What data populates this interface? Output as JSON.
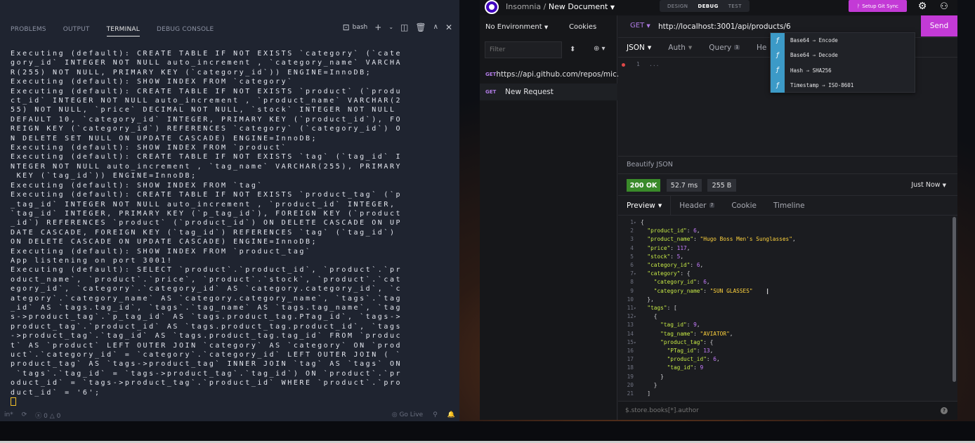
{
  "terminal_panel": {
    "tabs": [
      {
        "label": "PROBLEMS",
        "active": false
      },
      {
        "label": "OUTPUT",
        "active": false
      },
      {
        "label": "TERMINAL",
        "active": true
      },
      {
        "label": "DEBUG CONSOLE",
        "active": false
      }
    ],
    "shell_label": "bash",
    "lines": [
      "Executing (default): CREATE TABLE IF NOT EXISTS `category` (`cate",
      "gory_id` INTEGER NOT NULL auto_increment , `category_name` VARCHA",
      "R(255) NOT NULL, PRIMARY KEY (`category_id`)) ENGINE=InnoDB;",
      "Executing (default): SHOW INDEX FROM `category`",
      "Executing (default): CREATE TABLE IF NOT EXISTS `product` (`produ",
      "ct_id` INTEGER NOT NULL auto_increment , `product_name` VARCHAR(2",
      "55) NOT NULL, `price` DECIMAL NOT NULL, `stock` INTEGER NOT NULL",
      "DEFAULT 10, `category_id` INTEGER, PRIMARY KEY (`product_id`), FO",
      "REIGN KEY (`category_id`) REFERENCES `category` (`category_id`) O",
      "N DELETE SET NULL ON UPDATE CASCADE) ENGINE=InnoDB;",
      "Executing (default): SHOW INDEX FROM `product`",
      "Executing (default): CREATE TABLE IF NOT EXISTS `tag` (`tag_id` I",
      "NTEGER NOT NULL auto_increment , `tag_name` VARCHAR(255), PRIMARY",
      " KEY (`tag_id`)) ENGINE=InnoDB;",
      "Executing (default): SHOW INDEX FROM `tag`",
      "Executing (default): CREATE TABLE IF NOT EXISTS `product_tag` (`p",
      "_tag_id` INTEGER NOT NULL auto_increment , `product_id` INTEGER,",
      "`tag_id` INTEGER, PRIMARY KEY (`p_tag_id`), FOREIGN KEY (`product",
      "_id`) REFERENCES `product` (`product_id`) ON DELETE CASCADE ON UP",
      "DATE CASCADE, FOREIGN KEY (`tag_id`) REFERENCES `tag` (`tag_id`)",
      "ON DELETE CASCADE ON UPDATE CASCADE) ENGINE=InnoDB;",
      "Executing (default): SHOW INDEX FROM `product_tag`",
      "App listening on port 3001!",
      "Executing (default): SELECT `product`.`product_id`, `product`.`pr",
      "oduct_name`, `product`.`price`, `product`.`stock`, `product`.`cat",
      "egory_id`, `category`.`category_id` AS `category.category_id`, `c",
      "ategory`.`category_name` AS `category.category_name`, `tags`.`tag",
      "_id` AS `tags.tag_id`, `tags`.`tag_name` AS `tags.tag_name`, `tag",
      "s->product_tag`.`p_tag_id` AS `tags.product_tag.PTag_id`, `tags->",
      "product_tag`.`product_id` AS `tags.product_tag.product_id`, `tags",
      "->product_tag`.`tag_id` AS `tags.product_tag.tag_id` FROM `produc",
      "t` AS `product` LEFT OUTER JOIN `category` AS `category` ON `prod",
      "uct`.`category_id` = `category`.`category_id` LEFT OUTER JOIN ( `",
      "product_tag` AS `tags->product_tag` INNER JOIN `tag` AS `tags` ON",
      " `tags`.`tag_id` = `tags->product_tag`.`tag_id`) ON `product`.`pr",
      "oduct_id` = `tags->product_tag`.`product_id` WHERE `product`.`pro",
      "duct_id` = '6';"
    ],
    "status": {
      "left_fragment": "in*",
      "problems_count": "0",
      "warnings_count": "0",
      "go_live": "Go Live"
    }
  },
  "insomnia": {
    "app_name": "Insomnia",
    "separator": "/",
    "document_name": "New Document",
    "modes": [
      {
        "label": "DESIGN",
        "active": false
      },
      {
        "label": "DEBUG",
        "active": true
      },
      {
        "label": "TEST",
        "active": false
      }
    ],
    "git_sync_label": "Setup Git Sync",
    "sidebar": {
      "environment": "No Environment",
      "cookies": "Cookies",
      "filter_placeholder": "Filter",
      "requests": [
        {
          "method": "GET",
          "name": "https://api.github.com/repos/mic...",
          "active": false
        },
        {
          "method": "GET",
          "name": "New Request",
          "active": true
        }
      ]
    },
    "request": {
      "method": "GET",
      "url": "http://localhost:3001/api/products/6",
      "send_label": "Send",
      "tabs": [
        {
          "label": "JSON",
          "badge": "",
          "active": true
        },
        {
          "label": "Auth",
          "badge": "",
          "active": false
        },
        {
          "label": "Query",
          "badge": "1",
          "active": false
        },
        {
          "label": "He",
          "badge": "",
          "active": false
        }
      ],
      "body_line_number": "1",
      "body_placeholder": "...",
      "autocomplete": [
        "Base64 ⇒ Encode",
        "Base64 ⇒ Decode",
        "Hash ⇒ SHA256",
        "Timestamp ⇒ ISO-8601"
      ],
      "beautify_label": "Beautify JSON"
    },
    "response": {
      "status": "200 OK",
      "time": "52.7 ms",
      "size": "255 B",
      "history": "Just Now",
      "tabs": [
        {
          "label": "Preview",
          "badge": "",
          "active": true
        },
        {
          "label": "Header",
          "badge": "7",
          "active": false
        },
        {
          "label": "Cookie",
          "badge": "",
          "active": false
        },
        {
          "label": "Timeline",
          "badge": "",
          "active": false
        }
      ],
      "body_lines": [
        {
          "n": "1",
          "fold": true,
          "parts": [
            {
              "t": "{",
              "c": "p"
            }
          ]
        },
        {
          "n": "2",
          "fold": false,
          "parts": [
            {
              "t": "  ",
              "c": "p"
            },
            {
              "t": "\"product_id\"",
              "c": "k"
            },
            {
              "t": ": ",
              "c": "p"
            },
            {
              "t": "6",
              "c": "n"
            },
            {
              "t": ",",
              "c": "p"
            }
          ]
        },
        {
          "n": "3",
          "fold": false,
          "parts": [
            {
              "t": "  ",
              "c": "p"
            },
            {
              "t": "\"product_name\"",
              "c": "k"
            },
            {
              "t": ": ",
              "c": "p"
            },
            {
              "t": "\"Hugo Boss Men's Sunglasses\"",
              "c": "s"
            },
            {
              "t": ",",
              "c": "p"
            }
          ]
        },
        {
          "n": "4",
          "fold": false,
          "parts": [
            {
              "t": "  ",
              "c": "p"
            },
            {
              "t": "\"price\"",
              "c": "k"
            },
            {
              "t": ": ",
              "c": "p"
            },
            {
              "t": "117",
              "c": "n"
            },
            {
              "t": ",",
              "c": "p"
            }
          ]
        },
        {
          "n": "5",
          "fold": false,
          "parts": [
            {
              "t": "  ",
              "c": "p"
            },
            {
              "t": "\"stock\"",
              "c": "k"
            },
            {
              "t": ": ",
              "c": "p"
            },
            {
              "t": "5",
              "c": "n"
            },
            {
              "t": ",",
              "c": "p"
            }
          ]
        },
        {
          "n": "6",
          "fold": false,
          "parts": [
            {
              "t": "  ",
              "c": "p"
            },
            {
              "t": "\"category_id\"",
              "c": "k"
            },
            {
              "t": ": ",
              "c": "p"
            },
            {
              "t": "6",
              "c": "n"
            },
            {
              "t": ",",
              "c": "p"
            }
          ]
        },
        {
          "n": "7",
          "fold": true,
          "parts": [
            {
              "t": "  ",
              "c": "p"
            },
            {
              "t": "\"category\"",
              "c": "k"
            },
            {
              "t": ": {",
              "c": "p"
            }
          ]
        },
        {
          "n": "8",
          "fold": false,
          "parts": [
            {
              "t": "    ",
              "c": "p"
            },
            {
              "t": "\"category_id\"",
              "c": "k"
            },
            {
              "t": ": ",
              "c": "p"
            },
            {
              "t": "6",
              "c": "n"
            },
            {
              "t": ",",
              "c": "p"
            }
          ]
        },
        {
          "n": "9",
          "fold": false,
          "parts": [
            {
              "t": "    ",
              "c": "p"
            },
            {
              "t": "\"category_name\"",
              "c": "k"
            },
            {
              "t": ": ",
              "c": "p"
            },
            {
              "t": "\"SUN GLASSES\"",
              "c": "s"
            }
          ]
        },
        {
          "n": "10",
          "fold": false,
          "parts": [
            {
              "t": "  },",
              "c": "p"
            }
          ]
        },
        {
          "n": "11",
          "fold": true,
          "parts": [
            {
              "t": "  ",
              "c": "p"
            },
            {
              "t": "\"tags\"",
              "c": "k"
            },
            {
              "t": ": [",
              "c": "p"
            }
          ]
        },
        {
          "n": "12",
          "fold": true,
          "parts": [
            {
              "t": "    {",
              "c": "p"
            }
          ]
        },
        {
          "n": "13",
          "fold": false,
          "parts": [
            {
              "t": "      ",
              "c": "p"
            },
            {
              "t": "\"tag_id\"",
              "c": "k"
            },
            {
              "t": ": ",
              "c": "p"
            },
            {
              "t": "9",
              "c": "n"
            },
            {
              "t": ",",
              "c": "p"
            }
          ]
        },
        {
          "n": "14",
          "fold": false,
          "parts": [
            {
              "t": "      ",
              "c": "p"
            },
            {
              "t": "\"tag_name\"",
              "c": "k"
            },
            {
              "t": ": ",
              "c": "p"
            },
            {
              "t": "\"AVIATOR\"",
              "c": "s"
            },
            {
              "t": ",",
              "c": "p"
            }
          ]
        },
        {
          "n": "15",
          "fold": true,
          "parts": [
            {
              "t": "      ",
              "c": "p"
            },
            {
              "t": "\"product_tag\"",
              "c": "k"
            },
            {
              "t": ": {",
              "c": "p"
            }
          ]
        },
        {
          "n": "16",
          "fold": false,
          "parts": [
            {
              "t": "        ",
              "c": "p"
            },
            {
              "t": "\"PTag_id\"",
              "c": "k"
            },
            {
              "t": ": ",
              "c": "p"
            },
            {
              "t": "13",
              "c": "n"
            },
            {
              "t": ",",
              "c": "p"
            }
          ]
        },
        {
          "n": "17",
          "fold": false,
          "parts": [
            {
              "t": "        ",
              "c": "p"
            },
            {
              "t": "\"product_id\"",
              "c": "k"
            },
            {
              "t": ": ",
              "c": "p"
            },
            {
              "t": "6",
              "c": "n"
            },
            {
              "t": ",",
              "c": "p"
            }
          ]
        },
        {
          "n": "18",
          "fold": false,
          "parts": [
            {
              "t": "        ",
              "c": "p"
            },
            {
              "t": "\"tag_id\"",
              "c": "k"
            },
            {
              "t": ": ",
              "c": "p"
            },
            {
              "t": "9",
              "c": "n"
            }
          ]
        },
        {
          "n": "19",
          "fold": false,
          "parts": [
            {
              "t": "      }",
              "c": "p"
            }
          ]
        },
        {
          "n": "20",
          "fold": false,
          "parts": [
            {
              "t": "    }",
              "c": "p"
            }
          ]
        },
        {
          "n": "21",
          "fold": false,
          "parts": [
            {
              "t": "  ]",
              "c": "p"
            }
          ]
        }
      ],
      "filter_placeholder": "$.store.books[*].author",
      "help_glyph": "?"
    }
  },
  "colors": {
    "accent": "#c33ad6",
    "status_ok": "#3a8a2a",
    "method_get": "#b17ce6",
    "json_key": "#c7ea46",
    "json_string": "#ffd33d",
    "json_number": "#c77dff"
  }
}
